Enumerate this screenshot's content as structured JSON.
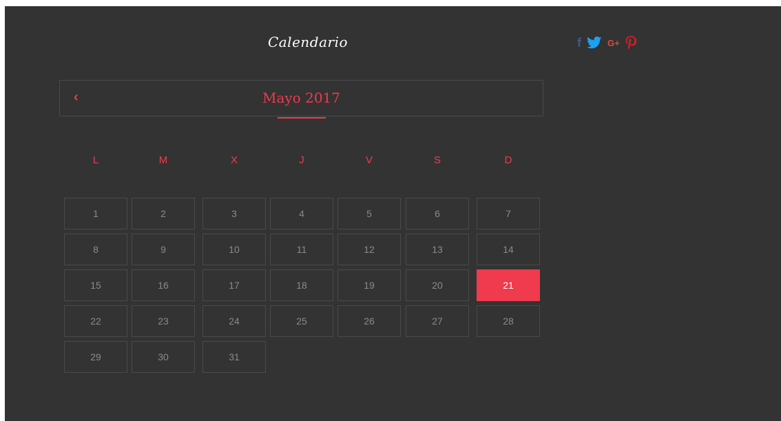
{
  "header": {
    "title": "Calendario"
  },
  "social": [
    {
      "name": "facebook-icon",
      "glyph": "f"
    },
    {
      "name": "twitter-icon",
      "glyph": ""
    },
    {
      "name": "google-plus-icon",
      "glyph": "G+"
    },
    {
      "name": "pinterest-icon",
      "glyph": "P"
    }
  ],
  "calendar": {
    "prev_glyph": "‹",
    "month_label": "Mayo 2017",
    "weekdays": [
      "L",
      "M",
      "X",
      "J",
      "V",
      "S",
      "D"
    ],
    "days": [
      "1",
      "2",
      "3",
      "4",
      "5",
      "6",
      "7",
      "8",
      "9",
      "10",
      "11",
      "12",
      "13",
      "14",
      "15",
      "16",
      "17",
      "18",
      "19",
      "20",
      "21",
      "22",
      "23",
      "24",
      "25",
      "26",
      "27",
      "28",
      "29",
      "30",
      "31"
    ],
    "selected_day": "21",
    "accent_color": "#f03a4e",
    "background_color": "#333333"
  }
}
